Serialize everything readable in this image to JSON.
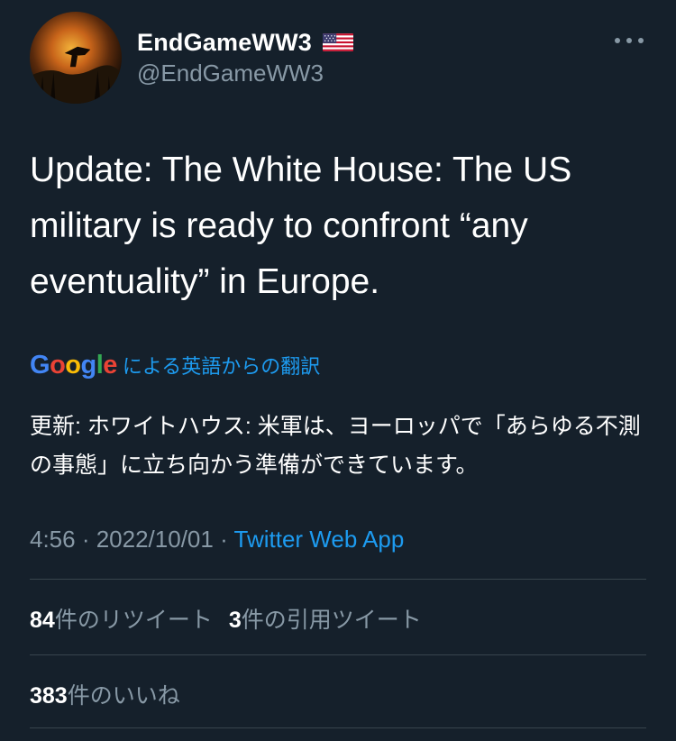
{
  "header": {
    "display_name": "EndGameWW3",
    "flag_icon": "us-flag-icon",
    "handle": "@EndGameWW3",
    "more_icon": "more-horizontal-icon"
  },
  "tweet": {
    "text": "Update: The White House: The US military is ready to confront “any eventuality” in Europe."
  },
  "translation": {
    "google_logo": "Google",
    "label": "による英語からの翻訳",
    "text": "更新: ホワイトハウス: 米軍は、ヨーロッパで「あらゆる不測の事態」に立ち向かう準備ができています。"
  },
  "meta": {
    "time": "4:56",
    "sep1": " · ",
    "date": "2022/10/01",
    "sep2": " · ",
    "source": "Twitter Web App"
  },
  "stats": {
    "retweets_count": "84",
    "retweets_label": "件のリツイート",
    "quotes_count": "3",
    "quotes_label": "件の引用ツイート",
    "likes_count": "383",
    "likes_label": "件のいいね"
  },
  "colors": {
    "background": "#15202b",
    "text_primary": "#ffffff",
    "text_secondary": "#8899a6",
    "accent": "#1d9bf0",
    "divider": "#38444d"
  }
}
